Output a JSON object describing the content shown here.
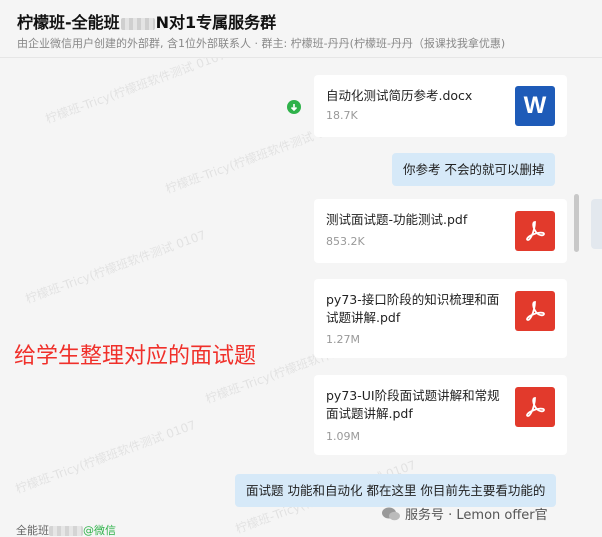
{
  "header": {
    "title_prefix": "柠檬班-全能班",
    "title_suffix": "N对1专属服务群",
    "subtitle": "由企业微信用户创建的外部群, 含1位外部联系人 · 群主: 柠檬班-丹丹(柠檬班-丹丹（报课找我拿优惠)"
  },
  "watermark": "柠檬班-Tricy(柠檬班软件测试 0107",
  "messages": {
    "file1": {
      "name": "自动化测试简历参考.docx",
      "size": "18.7K",
      "icon": "word-doc-icon",
      "icon_letter": "W"
    },
    "bubble1": "你参考  不会的就可以删掉",
    "file2": {
      "name": "测试面试题-功能测试.pdf",
      "size": "853.2K",
      "icon": "pdf-icon"
    },
    "file3": {
      "name": "py73-接口阶段的知识梳理和面试题讲解.pdf",
      "size": "1.27M",
      "icon": "pdf-icon"
    },
    "file4": {
      "name": "py73-UI阶段面试题讲解和常规面试题讲解.pdf",
      "size": "1.09M",
      "icon": "pdf-icon"
    },
    "bubble2": "面试题 功能和自动化 都在这里  你目前先主要看功能的"
  },
  "annotation": "给学生整理对应的面试题",
  "footer": {
    "sender_prefix": "全能班",
    "sender_source": "@微信",
    "brand": "服务号 · Lemon offer官"
  },
  "colors": {
    "bubble": "#d6e9f8",
    "annotation": "#f0302a",
    "pdf": "#e23a2c",
    "word": "#1e5bb8",
    "wechat_green": "#2fb24a"
  }
}
